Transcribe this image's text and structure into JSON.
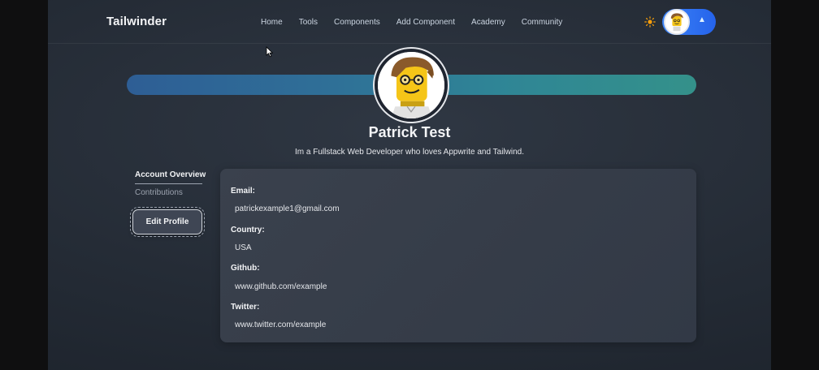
{
  "navbar": {
    "brand": "Tailwinder",
    "links": [
      "Home",
      "Tools",
      "Components",
      "Add Component",
      "Academy",
      "Community"
    ],
    "theme_icon": "sun-icon",
    "menu_icon": "chevron-up-icon"
  },
  "profile": {
    "name": "Patrick Test",
    "bio": "Im a Fullstack Web Developer who loves Appwrite and Tailwind."
  },
  "sidebar": {
    "items": [
      {
        "label": "Account Overview",
        "active": true
      },
      {
        "label": "Contributions",
        "active": false
      }
    ],
    "edit_button": "Edit Profile"
  },
  "details": {
    "fields": [
      {
        "label": "Email:",
        "value": "patrickexample1@gmail.com"
      },
      {
        "label": "Country:",
        "value": "USA"
      },
      {
        "label": "Github:",
        "value": "www.github.com/example"
      },
      {
        "label": "Twitter:",
        "value": "www.twitter.com/example"
      }
    ]
  },
  "colors": {
    "accent": "#3b82f6",
    "banner_start": "#2e5e95",
    "banner_end": "#34918a",
    "sun": "#f59e0b"
  }
}
